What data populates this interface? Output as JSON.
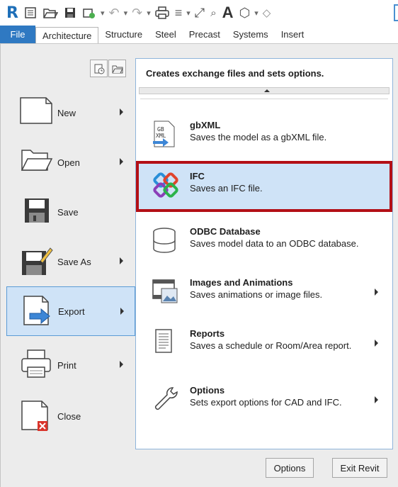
{
  "quick_access_toolbar": {
    "icons": [
      "revit-logo-icon",
      "list-icon",
      "open-folder-icon",
      "save-icon",
      "sync-icon",
      "undo-icon",
      "redo-icon",
      "print-icon",
      "measure-icon",
      "dimension-icon",
      "tag-icon",
      "text-icon",
      "3d-view-icon",
      "section-icon"
    ],
    "logo_text": "R",
    "text_tool_glyph": "A"
  },
  "ribbon_tabs": [
    {
      "label": "File",
      "active": false,
      "file_tab": true
    },
    {
      "label": "Architecture",
      "active": true
    },
    {
      "label": "Structure",
      "active": false
    },
    {
      "label": "Steel",
      "active": false
    },
    {
      "label": "Precast",
      "active": false
    },
    {
      "label": "Systems",
      "active": false
    },
    {
      "label": "Insert",
      "active": false
    }
  ],
  "left_menu": [
    {
      "label": "New",
      "icon": "new-document-icon",
      "has_submenu": true,
      "selected": false
    },
    {
      "label": "Open",
      "icon": "open-folder-icon",
      "has_submenu": true,
      "selected": false
    },
    {
      "label": "Save",
      "icon": "save-icon",
      "has_submenu": false,
      "selected": false
    },
    {
      "label": "Save As",
      "icon": "save-as-icon",
      "has_submenu": true,
      "selected": false
    },
    {
      "label": "Export",
      "icon": "export-icon",
      "has_submenu": true,
      "selected": true
    },
    {
      "label": "Print",
      "icon": "print-icon",
      "has_submenu": true,
      "selected": false
    },
    {
      "label": "Close",
      "icon": "close-document-icon",
      "has_submenu": false,
      "selected": false
    }
  ],
  "right_pane": {
    "header": "Creates exchange files and sets options.",
    "items": [
      {
        "title": "gbXML",
        "description": "Saves the model as a gbXML file.",
        "icon": "gbxml-icon",
        "has_submenu": false,
        "highlighted": false
      },
      {
        "title": "IFC",
        "description": "Saves an IFC file.",
        "icon": "ifc-icon",
        "has_submenu": false,
        "highlighted": true
      },
      {
        "title": "ODBC Database",
        "description": "Saves model data to an ODBC database.",
        "icon": "database-icon",
        "has_submenu": false,
        "highlighted": false
      },
      {
        "title": "Images and Animations",
        "description": "Saves animations or image files.",
        "icon": "film-icon",
        "has_submenu": true,
        "highlighted": false
      },
      {
        "title": "Reports",
        "description": "Saves a schedule or Room/Area report.",
        "icon": "report-icon",
        "has_submenu": true,
        "highlighted": false
      },
      {
        "title": "Options",
        "description": "Sets export options for CAD and IFC.",
        "icon": "wrench-icon",
        "has_submenu": true,
        "highlighted": false
      }
    ]
  },
  "bottom_buttons": {
    "options_label": "Options",
    "exit_label": "Exit Revit"
  },
  "colors": {
    "file_tab": "#2f79c2",
    "selection_fill": "#cfe3f7",
    "highlight_border": "#b30f16",
    "menu_background": "#ececec"
  }
}
